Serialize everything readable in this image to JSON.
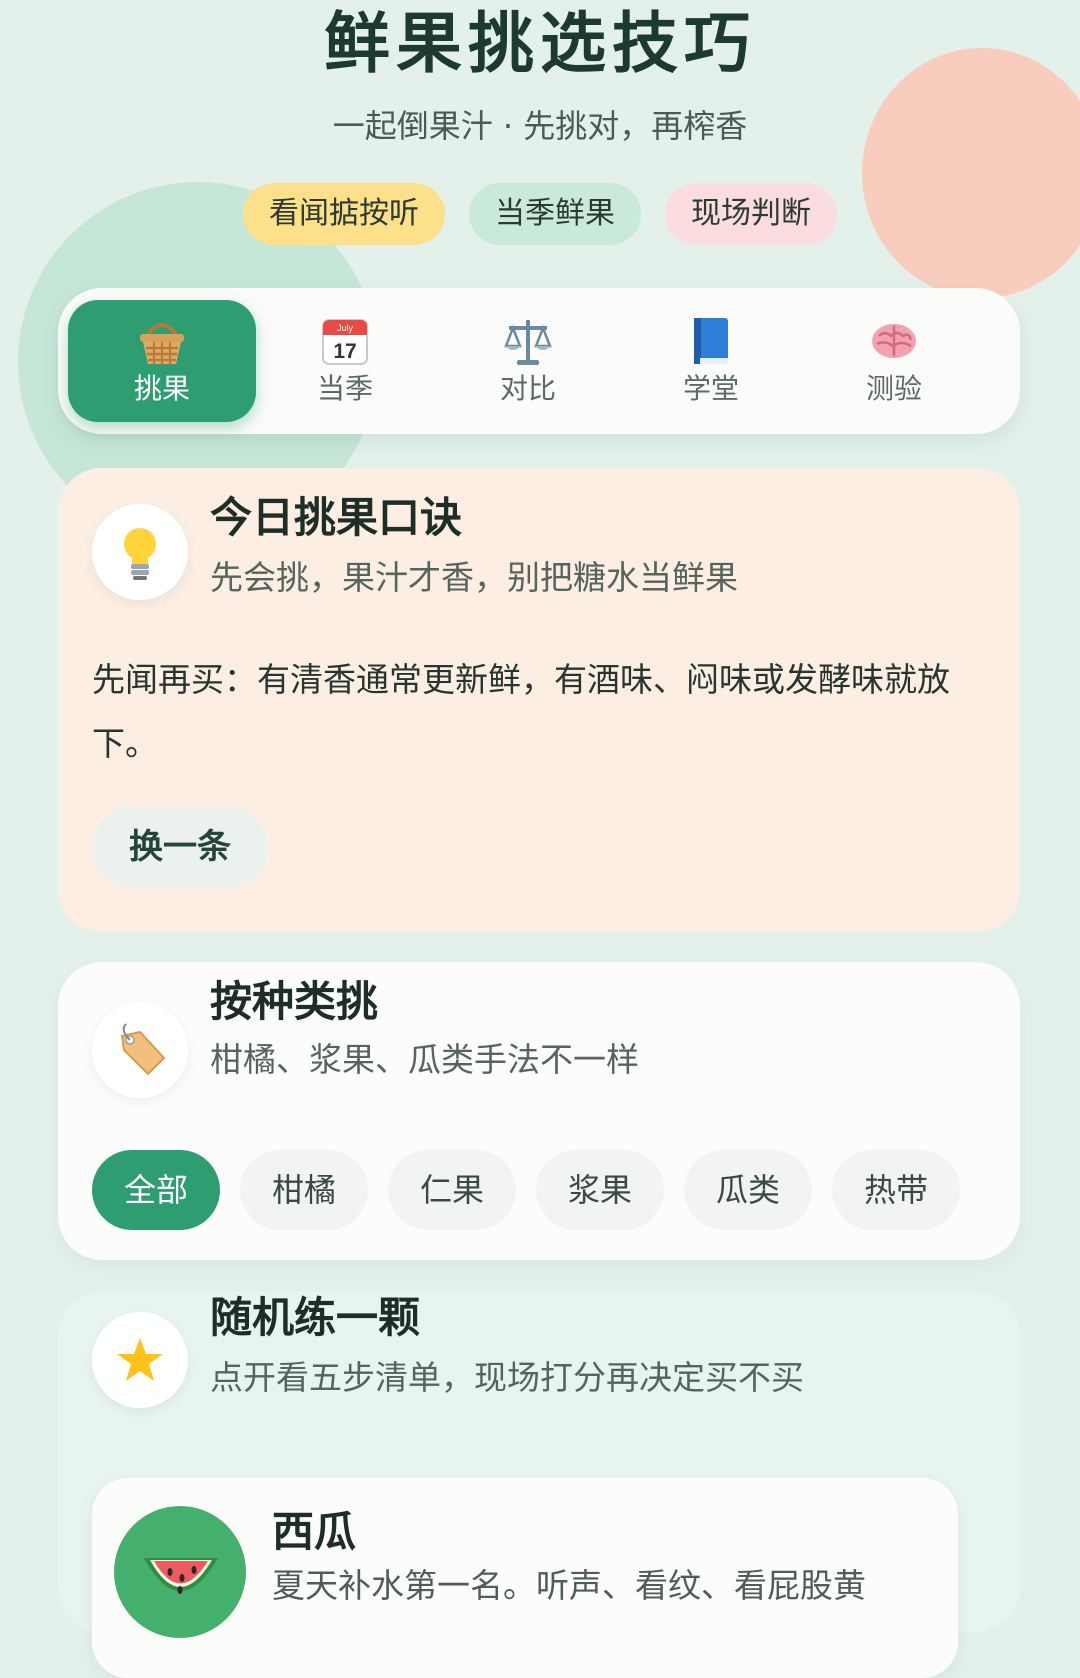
{
  "header": {
    "title": "鲜果挑选技巧",
    "subtitle": "一起倒果汁 · 先挑对，再榨香",
    "chips": [
      "看闻掂按听",
      "当季鲜果",
      "现场判断"
    ]
  },
  "tabs": [
    {
      "label": "挑果",
      "icon": "basket-icon",
      "active": true
    },
    {
      "label": "当季",
      "icon": "calendar-icon",
      "calendar_month": "July",
      "calendar_day": "17",
      "active": false
    },
    {
      "label": "对比",
      "icon": "scale-icon",
      "active": false
    },
    {
      "label": "学堂",
      "icon": "book-icon",
      "active": false
    },
    {
      "label": "测验",
      "icon": "brain-icon",
      "active": false
    }
  ],
  "tip_card": {
    "icon": "lightbulb-icon",
    "title": "今日挑果口诀",
    "subtitle": "先会挑，果汁才香，别把糖水当鲜果",
    "body": "先闻再买：有清香通常更新鲜，有酒味、闷味或发酵味就放下。",
    "button": "换一条"
  },
  "category_card": {
    "icon": "tag-icon",
    "title": "按种类挑",
    "subtitle": "柑橘、浆果、瓜类手法不一样",
    "filters": [
      "全部",
      "柑橘",
      "仁果",
      "浆果",
      "瓜类",
      "热带"
    ],
    "active_filter": "全部"
  },
  "practice_card": {
    "icon": "star-icon",
    "title": "随机练一颗",
    "subtitle": "点开看五步清单，现场打分再决定买不买",
    "fruit": {
      "name": "西瓜",
      "description": "夏天补水第一名。听声、看纹、看屁股黄",
      "icon": "watermelon-icon"
    }
  },
  "colors": {
    "accent": "#2e9e72",
    "background": "#e3f1ea",
    "tip_card": "#fdeee3",
    "chip_yellow": "#fde08a",
    "chip_green": "#c9ead9",
    "chip_pink": "#fbdde0"
  }
}
